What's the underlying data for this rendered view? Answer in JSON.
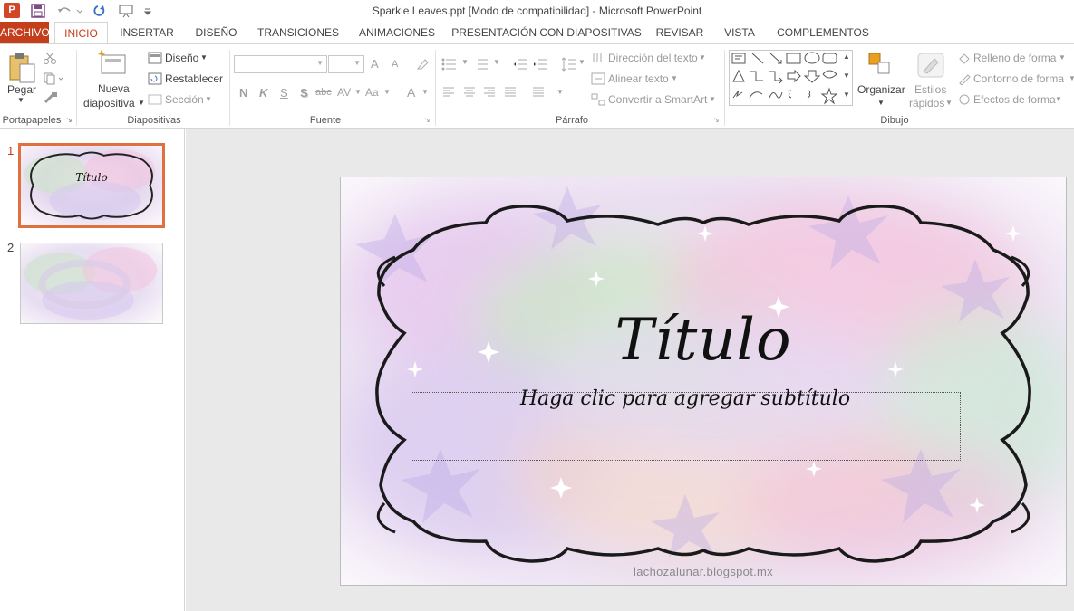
{
  "window": {
    "title": "Sparkle Leaves.ppt [Modo de compatibilidad] - Microsoft PowerPoint",
    "app_icon": "P"
  },
  "tabs": [
    {
      "label": "ARCHIVO"
    },
    {
      "label": "INICIO"
    },
    {
      "label": "INSERTAR"
    },
    {
      "label": "DISEÑO"
    },
    {
      "label": "TRANSICIONES"
    },
    {
      "label": "ANIMACIONES"
    },
    {
      "label": "PRESENTACIÓN CON DIAPOSITIVAS"
    },
    {
      "label": "REVISAR"
    },
    {
      "label": "VISTA"
    },
    {
      "label": "COMPLEMENTOS"
    }
  ],
  "ribbon": {
    "clipboard": {
      "paste_label": "Pegar",
      "group_label": "Portapapeles"
    },
    "slides": {
      "new_slide_line1": "Nueva",
      "new_slide_line2": "diapositiva",
      "layout_label": "Diseño",
      "reset_label": "Restablecer",
      "section_label": "Sección",
      "group_label": "Diapositivas"
    },
    "font": {
      "group_label": "Fuente",
      "bold": "N",
      "italic": "K",
      "underline": "S",
      "shadow": "S",
      "strike": "abc",
      "spacing": "AV",
      "case": "Aa",
      "grow": "A",
      "shrink": "A",
      "color": "A"
    },
    "paragraph": {
      "text_direction": "Dirección del texto",
      "align_text": "Alinear texto",
      "convert_smartart": "Convertir a SmartArt",
      "group_label": "Párrafo"
    },
    "drawing": {
      "arrange_label": "Organizar",
      "quick_styles_line1": "Estilos",
      "quick_styles_line2": "rápidos",
      "shape_fill": "Relleno de forma",
      "shape_outline": "Contorno de forma",
      "shape_effects": "Efectos de forma",
      "group_label": "Dibujo"
    }
  },
  "slides_pane": [
    {
      "number": "1",
      "selected": true,
      "title": "Título"
    },
    {
      "number": "2",
      "selected": false
    }
  ],
  "slide": {
    "title": "Título",
    "subtitle_placeholder": "Haga clic para agregar subtítulo",
    "footer": "lachozalunar.blogspot.mx"
  },
  "colors": {
    "accent": "#c43e1c"
  }
}
